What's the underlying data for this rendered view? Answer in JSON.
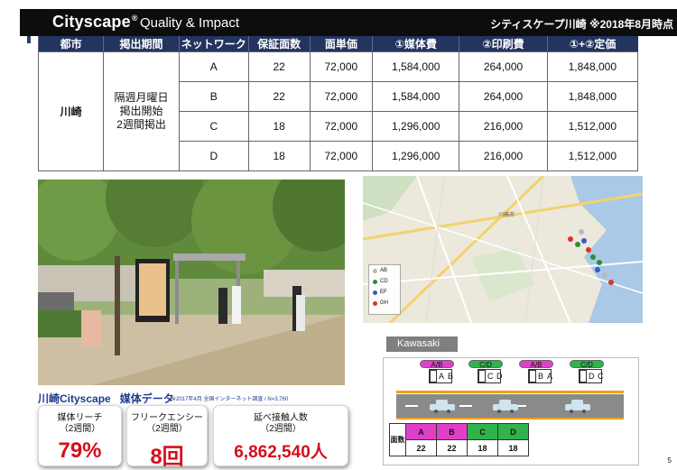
{
  "header": {
    "brand": "Cityscape",
    "reg": "®",
    "tagline": "Quality & Impact",
    "right_text": "シティスケープ川崎 ※2018年8月時点"
  },
  "price_table": {
    "headers": [
      "都市",
      "掲出期間",
      "ネットワーク",
      "保証面数",
      "面単価",
      "①媒体費",
      "②印刷費",
      "①+②定価"
    ],
    "city": "川崎",
    "period_lines": [
      "隔週月曜日",
      "掲出開始",
      "2週間掲出"
    ],
    "rows": [
      [
        "A",
        "22",
        "72,000",
        "1,584,000",
        "264,000",
        "1,848,000"
      ],
      [
        "B",
        "22",
        "72,000",
        "1,584,000",
        "264,000",
        "1,848,000"
      ],
      [
        "C",
        "18",
        "72,000",
        "1,296,000",
        "216,000",
        "1,512,000"
      ],
      [
        "D",
        "18",
        "72,000",
        "1,296,000",
        "216,000",
        "1,512,000"
      ]
    ]
  },
  "media_data": {
    "title_city": "川崎Cityscape",
    "title_label": "媒体データ",
    "note": "※2017年4月 全国インターネット調査 / N=3,760",
    "stats": [
      {
        "label": "媒体リーチ",
        "sub": "（2週間）",
        "value": "79%"
      },
      {
        "label": "フリークエンシー",
        "sub": "（2週間）",
        "value": "8回"
      },
      {
        "label": "延べ接触人数",
        "sub": "（2週間）",
        "value": "6,862,540人"
      }
    ]
  },
  "map": {
    "legend": [
      {
        "label": "AB",
        "color": "#b9b9b9"
      },
      {
        "label": "CD",
        "color": "#2e8b3a"
      },
      {
        "label": "EF",
        "color": "#3c5bbf"
      },
      {
        "label": "GH",
        "color": "#d8342c"
      }
    ],
    "place_label": "川崎市"
  },
  "diagram": {
    "title": "Kawasaki",
    "pills": [
      {
        "label": "A/B",
        "color": "#e040c8"
      },
      {
        "label": "C/D",
        "color": "#2fb34a"
      },
      {
        "label": "A/B",
        "color": "#e040c8"
      },
      {
        "label": "C/D",
        "color": "#2fb34a"
      }
    ],
    "panel_letters": [
      [
        "A",
        "B"
      ],
      [
        "C",
        "D"
      ],
      [
        "B",
        "A"
      ],
      [
        "D",
        "C"
      ]
    ],
    "count_side_label": "面数",
    "count_headers": [
      {
        "label": "A",
        "color": "#e040c8"
      },
      {
        "label": "B",
        "color": "#e040c8"
      },
      {
        "label": "C",
        "color": "#2fb34a"
      },
      {
        "label": "D",
        "color": "#2fb34a"
      }
    ],
    "counts": [
      "22",
      "22",
      "18",
      "18"
    ]
  },
  "page_number": "5"
}
